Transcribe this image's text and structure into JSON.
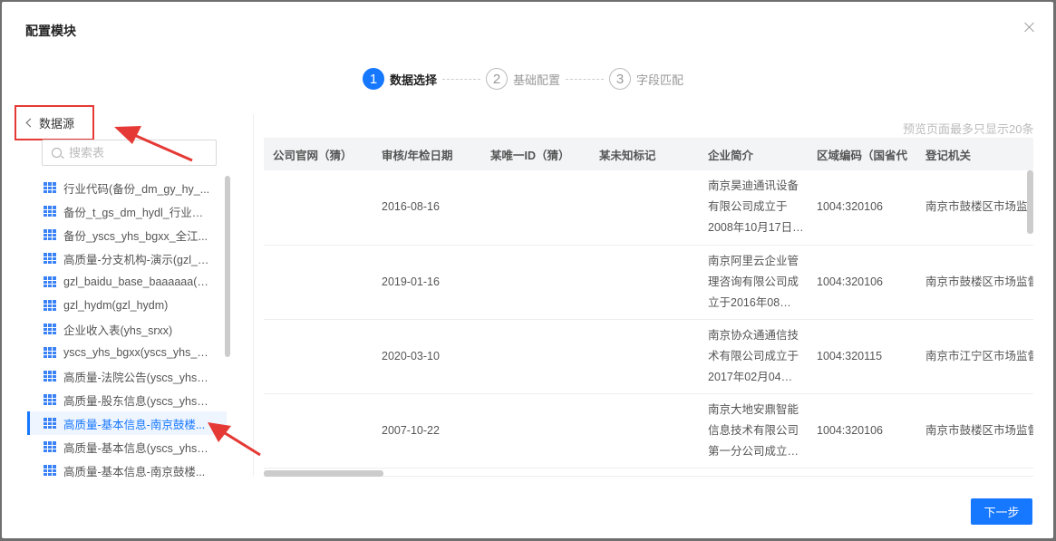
{
  "modal": {
    "title": "配置模块"
  },
  "steps": [
    {
      "num": "1",
      "label": "数据选择",
      "active": true
    },
    {
      "num": "2",
      "label": "基础配置",
      "active": false
    },
    {
      "num": "3",
      "label": "字段匹配",
      "active": false
    }
  ],
  "left": {
    "back_label": "数据源",
    "search_placeholder": "搜索表",
    "items": [
      {
        "label": "行业代码(备份_dm_gy_hy_..."
      },
      {
        "label": "备份_t_gs_dm_hydl_行业代..."
      },
      {
        "label": "备份_yscs_yhs_bgxx_全江..."
      },
      {
        "label": "高质量-分支机构-演示(gzl_a..."
      },
      {
        "label": "gzl_baidu_base_baaaaaa(g..."
      },
      {
        "label": "gzl_hydm(gzl_hydm)"
      },
      {
        "label": "企业收入表(yhs_srxx)"
      },
      {
        "label": "yscs_yhs_bgxx(yscs_yhs_b..."
      },
      {
        "label": "高质量-法院公告(yscs_yhs_..."
      },
      {
        "label": "高质量-股东信息(yscs_yhs_..."
      },
      {
        "label": "高质量-基本信息-南京鼓楼...",
        "selected": true
      },
      {
        "label": "高质量-基本信息(yscs_yhs_..."
      },
      {
        "label": "高质量-基本信息-南京鼓楼..."
      }
    ]
  },
  "preview": {
    "note": "预览页面最多只显示20条",
    "columns": [
      "公司官网（猜）",
      "审核/年检日期",
      "某唯一ID（猜）",
      "某未知标记",
      "企业简介",
      "区域编码（国省代",
      "登记机关"
    ],
    "rows": [
      [
        "",
        "2016-08-16",
        "",
        "",
        "南京昊迪通讯设备有限公司成立于2008年10月17日…",
        "1004:320106",
        "南京市鼓楼区市场监督管理局"
      ],
      [
        "",
        "2019-01-16",
        "",
        "",
        "南京阿里云企业管理咨询有限公司成立于2016年08…",
        "1004:320106",
        "南京市鼓楼区市场监督管理局"
      ],
      [
        "",
        "2020-03-10",
        "",
        "",
        "南京协众通通信技术有限公司成立于2017年02月04…",
        "1004:320115",
        "南京市江宁区市场监督管理局"
      ],
      [
        "",
        "2007-10-22",
        "",
        "",
        "南京大地安鼎智能信息技术有限公司第一分公司成立…",
        "1004:320106",
        "南京市鼓楼区市场监督管理局"
      ]
    ]
  },
  "footer": {
    "next_label": "下一步"
  },
  "colors": {
    "accent": "#1677ff",
    "highlight": "#e53935"
  }
}
